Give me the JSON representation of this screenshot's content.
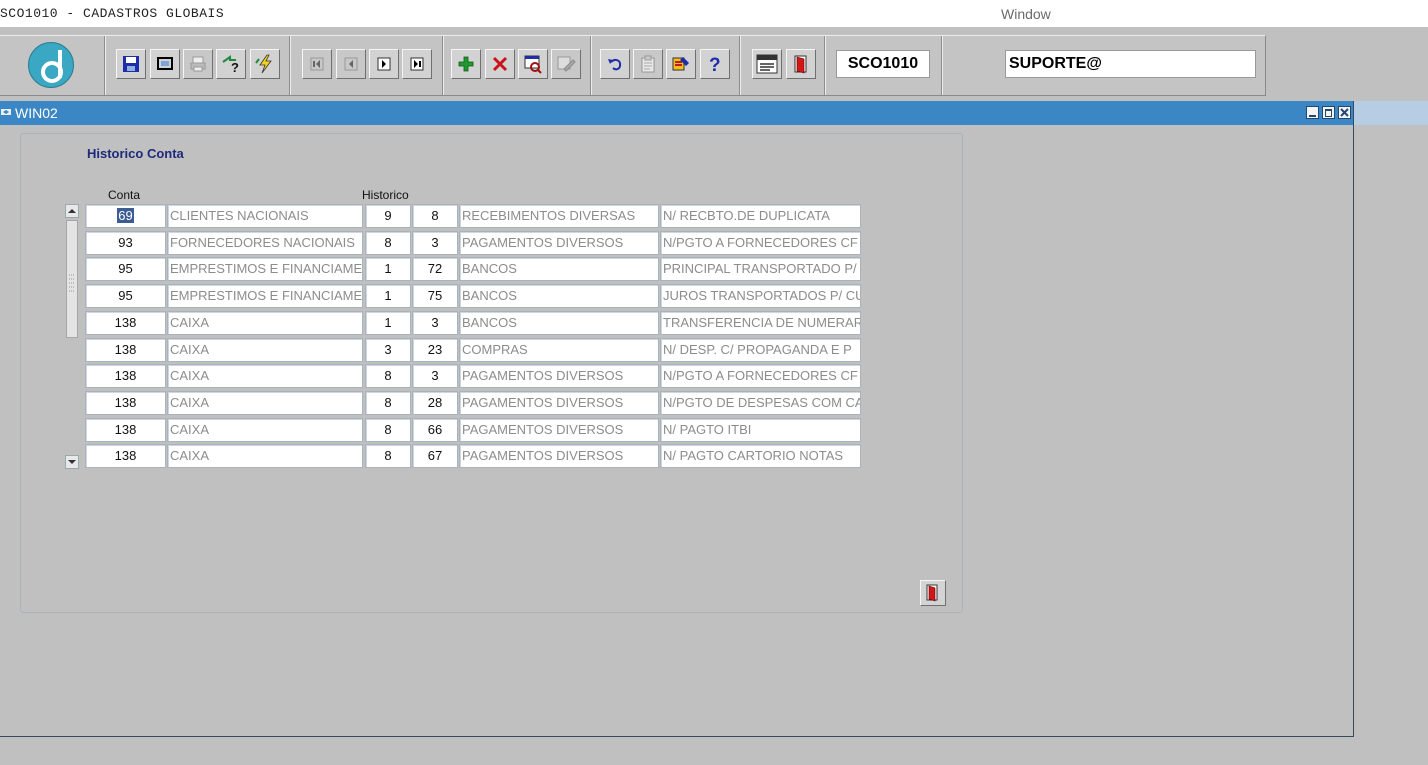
{
  "app": {
    "title": "SCO1010 - CADASTROS GLOBAIS",
    "window_menu": "Window"
  },
  "toolbar": {
    "buttons": [
      {
        "name": "save-button",
        "icon": "floppy-disk-icon"
      },
      {
        "name": "screen-button",
        "icon": "monitor-icon"
      },
      {
        "name": "print-button",
        "icon": "printer-icon"
      },
      {
        "name": "query-button",
        "icon": "query-icon"
      },
      {
        "name": "execute-query-button",
        "icon": "lightning-icon"
      },
      {
        "name": "first-record-button",
        "icon": "first-record-icon"
      },
      {
        "name": "previous-record-button",
        "icon": "previous-record-icon"
      },
      {
        "name": "next-record-button",
        "icon": "next-record-icon"
      },
      {
        "name": "last-record-button",
        "icon": "last-record-icon"
      },
      {
        "name": "insert-record-button",
        "icon": "plus-icon"
      },
      {
        "name": "delete-record-button",
        "icon": "delete-x-icon"
      },
      {
        "name": "lookup-button",
        "icon": "search-window-icon"
      },
      {
        "name": "edit-button",
        "icon": "pencil-icon"
      },
      {
        "name": "undo-button",
        "icon": "undo-icon"
      },
      {
        "name": "clipboard-button",
        "icon": "clipboard-icon"
      },
      {
        "name": "tools-button",
        "icon": "tools-icon"
      },
      {
        "name": "help-button",
        "icon": "help-icon"
      },
      {
        "name": "menu-button",
        "icon": "menu-icon"
      },
      {
        "name": "exit-button",
        "icon": "exit-door-icon"
      }
    ],
    "form_code": "SCO1010",
    "user": "SUPORTE@"
  },
  "window": {
    "title": "WIN02"
  },
  "panel": {
    "title": "Historico Conta",
    "col_conta": "Conta",
    "col_historico": "Historico"
  },
  "rows": [
    {
      "conta": "69",
      "conta_nome": "CLIENTES NACIONAIS",
      "hist_tipo": "9",
      "hist_cod": "8",
      "hist_nome": "RECEBIMENTOS DIVERSAS",
      "complemento": "N/ RECBTO.DE DUPLICATA"
    },
    {
      "conta": "93",
      "conta_nome": "FORNECEDORES NACIONAIS",
      "hist_tipo": "8",
      "hist_cod": "3",
      "hist_nome": "PAGAMENTOS DIVERSOS",
      "complemento": "N/PGTO A FORNECEDORES CF"
    },
    {
      "conta": "95",
      "conta_nome": "EMPRESTIMOS E FINANCIAME",
      "hist_tipo": "1",
      "hist_cod": "72",
      "hist_nome": "BANCOS",
      "complemento": "PRINCIPAL TRANSPORTADO P/"
    },
    {
      "conta": "95",
      "conta_nome": "EMPRESTIMOS E FINANCIAME",
      "hist_tipo": "1",
      "hist_cod": "75",
      "hist_nome": "BANCOS",
      "complemento": "JUROS TRANSPORTADOS P/ CU"
    },
    {
      "conta": "138",
      "conta_nome": "CAIXA",
      "hist_tipo": "1",
      "hist_cod": "3",
      "hist_nome": "BANCOS",
      "complemento": "TRANSFERENCIA DE NUMERAR"
    },
    {
      "conta": "138",
      "conta_nome": "CAIXA",
      "hist_tipo": "3",
      "hist_cod": "23",
      "hist_nome": "COMPRAS",
      "complemento": "N/ DESP. C/ PROPAGANDA E P"
    },
    {
      "conta": "138",
      "conta_nome": "CAIXA",
      "hist_tipo": "8",
      "hist_cod": "3",
      "hist_nome": "PAGAMENTOS DIVERSOS",
      "complemento": "N/PGTO A FORNECEDORES CF"
    },
    {
      "conta": "138",
      "conta_nome": "CAIXA",
      "hist_tipo": "8",
      "hist_cod": "28",
      "hist_nome": "PAGAMENTOS DIVERSOS",
      "complemento": "N/PGTO DE DESPESAS COM CA"
    },
    {
      "conta": "138",
      "conta_nome": "CAIXA",
      "hist_tipo": "8",
      "hist_cod": "66",
      "hist_nome": "PAGAMENTOS DIVERSOS",
      "complemento": "N/ PAGTO ITBI"
    },
    {
      "conta": "138",
      "conta_nome": "CAIXA",
      "hist_tipo": "8",
      "hist_cod": "67",
      "hist_nome": "PAGAMENTOS DIVERSOS",
      "complemento": "N/ PAGTO CARTORIO NOTAS"
    }
  ],
  "colors": {
    "window_titlebar": "#3b87c6",
    "panel_title": "#1e2a7a",
    "selection": "#3c5d94",
    "logo": "#3aa7c3"
  }
}
